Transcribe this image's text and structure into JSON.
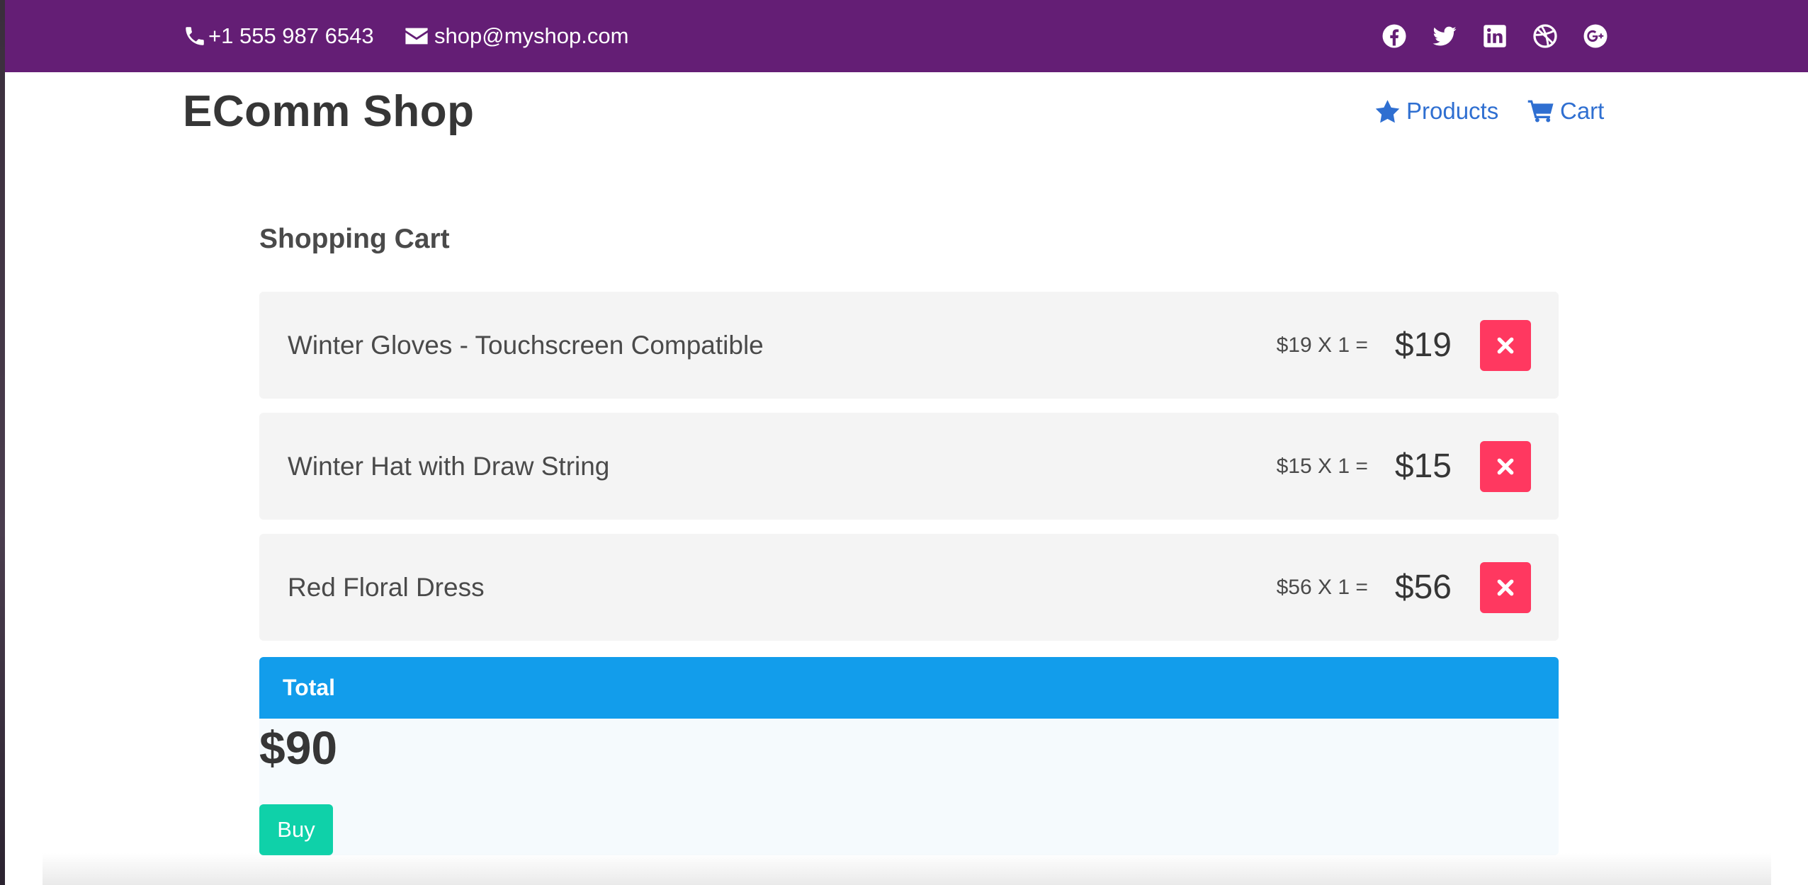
{
  "topbar": {
    "phone": "+1 555 987 6543",
    "email": "shop@myshop.com",
    "phone_icon": "phone-icon",
    "email_icon": "envelope-icon",
    "socials": [
      "facebook-icon",
      "twitter-icon",
      "linkedin-icon",
      "dribbble-icon",
      "google-plus-icon"
    ]
  },
  "navbar": {
    "brand": "EComm Shop",
    "products_label": "Products",
    "cart_label": "Cart",
    "products_icon": "star-icon",
    "cart_icon": "shopping-cart-icon"
  },
  "cart": {
    "title": "Shopping Cart",
    "items": [
      {
        "name": "Winter Gloves - Touchscreen Compatible",
        "calc": "$19 X 1 =",
        "total": "$19"
      },
      {
        "name": "Winter Hat with Draw String",
        "calc": "$15 X 1 =",
        "total": "$15"
      },
      {
        "name": "Red Floral Dress",
        "calc": "$56 X 1 =",
        "total": "$56"
      }
    ],
    "remove_icon": "close-icon"
  },
  "total": {
    "label": "Total",
    "amount": "$90",
    "buy_label": "Buy"
  },
  "colors": {
    "topbar": "#641e75",
    "link": "#2f6fd1",
    "danger": "#ff3860",
    "info": "#129deb",
    "primary": "#0fd1a9"
  }
}
